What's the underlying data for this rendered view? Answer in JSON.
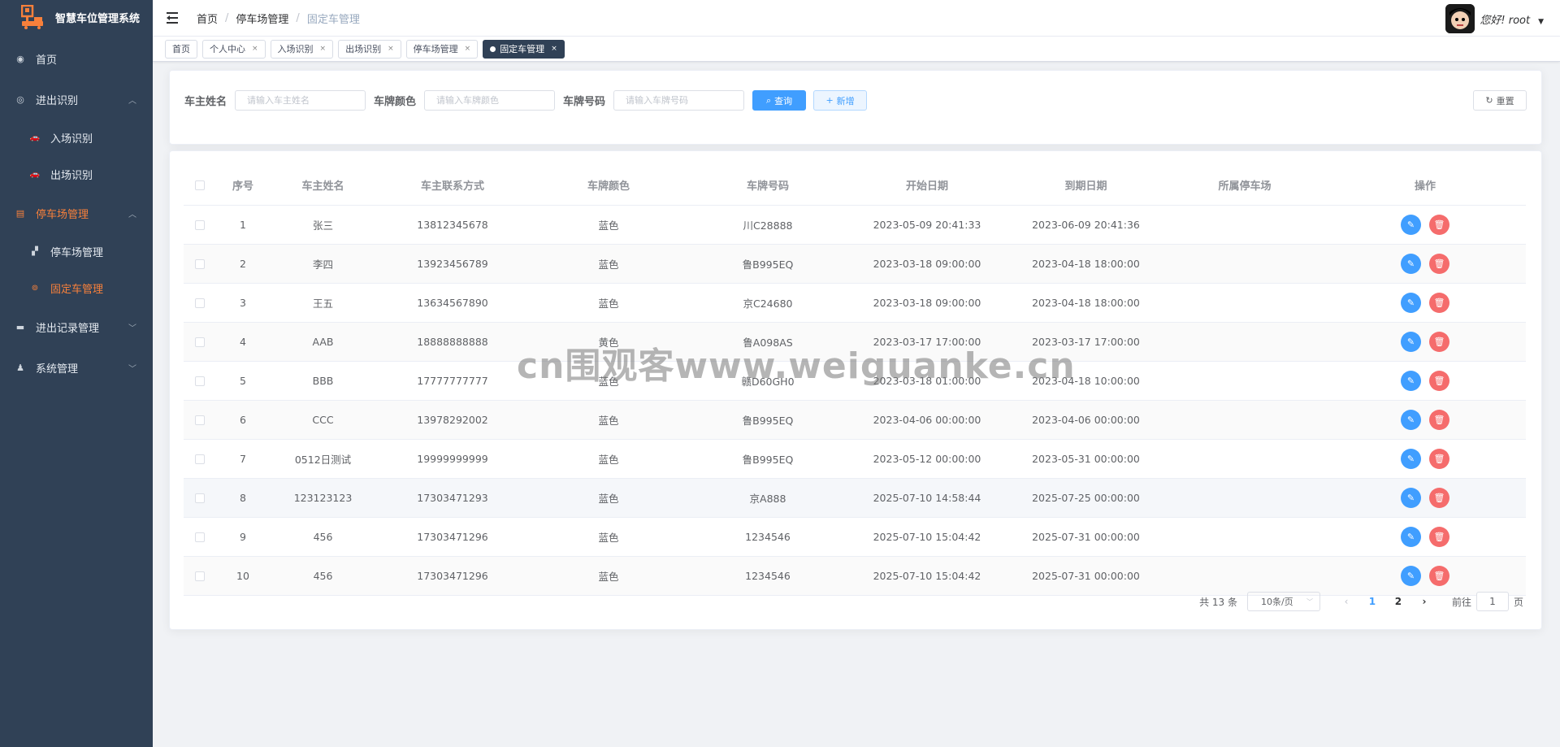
{
  "sidebar": {
    "logo_title": "智慧车位管理系统",
    "menu": [
      {
        "label": "首页",
        "icon": "dashboard-icon"
      },
      {
        "label": "进出识别",
        "icon": "camera-icon",
        "children": [
          {
            "label": "入场识别",
            "icon": "car-icon"
          },
          {
            "label": "出场识别",
            "icon": "car-icon"
          }
        ]
      },
      {
        "label": "停车场管理",
        "icon": "document-icon",
        "children": [
          {
            "label": "停车场管理",
            "icon": "parking-icon"
          },
          {
            "label": "固定车管理",
            "icon": "fixed-car-icon"
          }
        ]
      },
      {
        "label": "进出记录管理",
        "icon": "record-icon"
      },
      {
        "label": "系统管理",
        "icon": "user-icon"
      }
    ],
    "accent_color": "#f7803b"
  },
  "header": {
    "breadcrumb": [
      "首页",
      "停车场管理",
      "固定车管理"
    ],
    "greeting": "您好! root"
  },
  "tags": [
    {
      "label": "首页",
      "closable": false
    },
    {
      "label": "个人中心",
      "closable": true
    },
    {
      "label": "入场识别",
      "closable": true
    },
    {
      "label": "出场识别",
      "closable": true
    },
    {
      "label": "停车场管理",
      "closable": true
    },
    {
      "label": "固定车管理",
      "closable": true,
      "active": true
    }
  ],
  "search": {
    "owner_label": "车主姓名",
    "owner_placeholder": "请输入车主姓名",
    "color_label": "车牌颜色",
    "color_placeholder": "请输入车牌颜色",
    "plate_label": "车牌号码",
    "plate_placeholder": "请输入车牌号码",
    "query_label": "查询",
    "add_label": "新增",
    "reset_label": "重置"
  },
  "table": {
    "columns": [
      "序号",
      "车主姓名",
      "车主联系方式",
      "车牌颜色",
      "车牌号码",
      "开始日期",
      "到期日期",
      "所属停车场",
      "操作"
    ],
    "rows": [
      {
        "no": "1",
        "name": "张三",
        "phone": "13812345678",
        "color": "蓝色",
        "plate": "川C28888",
        "start": "2023-05-09 20:41:33",
        "end": "2023-06-09 20:41:36",
        "lot": ""
      },
      {
        "no": "2",
        "name": "李四",
        "phone": "13923456789",
        "color": "蓝色",
        "plate": "鲁B995EQ",
        "start": "2023-03-18 09:00:00",
        "end": "2023-04-18 18:00:00",
        "lot": ""
      },
      {
        "no": "3",
        "name": "王五",
        "phone": "13634567890",
        "color": "蓝色",
        "plate": "京C24680",
        "start": "2023-03-18 09:00:00",
        "end": "2023-04-18 18:00:00",
        "lot": ""
      },
      {
        "no": "4",
        "name": "AAB",
        "phone": "18888888888",
        "color": "黄色",
        "plate": "鲁A098AS",
        "start": "2023-03-17 17:00:00",
        "end": "2023-03-17 17:00:00",
        "lot": ""
      },
      {
        "no": "5",
        "name": "BBB",
        "phone": "17777777777",
        "color": "蓝色",
        "plate": "赣D60GH0",
        "start": "2023-03-18 01:00:00",
        "end": "2023-04-18 10:00:00",
        "lot": ""
      },
      {
        "no": "6",
        "name": "CCC",
        "phone": "13978292002",
        "color": "蓝色",
        "plate": "鲁B995EQ",
        "start": "2023-04-06 00:00:00",
        "end": "2023-04-06 00:00:00",
        "lot": ""
      },
      {
        "no": "7",
        "name": "0512日测试",
        "phone": "19999999999",
        "color": "蓝色",
        "plate": "鲁B995EQ",
        "start": "2023-05-12 00:00:00",
        "end": "2023-05-31 00:00:00",
        "lot": ""
      },
      {
        "no": "8",
        "name": "123123123",
        "phone": "17303471293",
        "color": "蓝色",
        "plate": "京A888",
        "start": "2025-07-10 14:58:44",
        "end": "2025-07-25 00:00:00",
        "lot": ""
      },
      {
        "no": "9",
        "name": "456",
        "phone": "17303471296",
        "color": "蓝色",
        "plate": "1234546",
        "start": "2025-07-10 15:04:42",
        "end": "2025-07-31 00:00:00",
        "lot": ""
      },
      {
        "no": "10",
        "name": "456",
        "phone": "17303471296",
        "color": "蓝色",
        "plate": "1234546",
        "start": "2025-07-10 15:04:42",
        "end": "2025-07-31 00:00:00",
        "lot": ""
      }
    ]
  },
  "pagination": {
    "total_text": "共 13 条",
    "page_size_text": "10条/页",
    "pages": [
      "1",
      "2"
    ],
    "current_page": "1",
    "jump_prefix": "前往",
    "jump_value": "1",
    "jump_suffix": "页"
  },
  "watermark": "cn围观客www.weiguanke.cn",
  "colors": {
    "sidebar_bg": "#304156",
    "primary": "#409eff",
    "danger": "#f56c6c"
  }
}
